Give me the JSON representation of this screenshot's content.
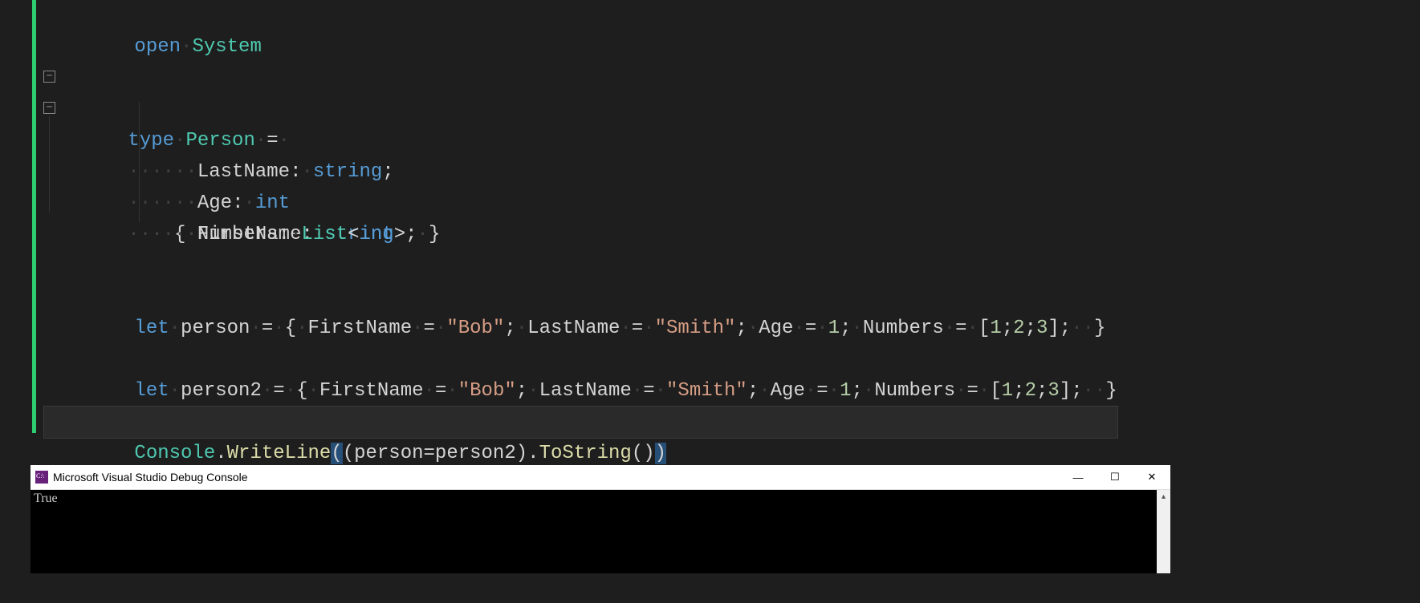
{
  "code": {
    "line1": {
      "open": "open",
      "ws": "·",
      "system": "System"
    },
    "line3": {
      "type": "type",
      "ws": "·",
      "person": "Person",
      "ws2": "·",
      "eq": "=",
      "ws3": "·"
    },
    "line4": {
      "indent": "····",
      "brace": "{",
      "ws": "·",
      "first": "FirstName",
      "colon": ":",
      "ws2": "·",
      "string": "string"
    },
    "line5": {
      "indent": "······",
      "last": "LastName",
      "colon": ":",
      "ws": "·",
      "string": "string",
      "semi": ";"
    },
    "line6": {
      "indent": "······",
      "age": "Age",
      "colon": ":",
      "ws": "·",
      "int": "int"
    },
    "line7": {
      "indent": "······",
      "numbers": "Numbers",
      "colon": ":",
      "ws": "·",
      "list": "List",
      "lt": "<",
      "int": "int",
      "gt": ">",
      "semi": ";",
      "ws2": "·",
      "brace": "}"
    },
    "line10": {
      "let": "let",
      "ws": "·",
      "person": "person",
      "ws2": "·",
      "eq": "=",
      "ws3": "·",
      "brace": "{",
      "ws4": "·",
      "first": "FirstName",
      "ws5": "·",
      "eq2": "=",
      "ws6": "·",
      "bob": "\"Bob\"",
      "semi": ";",
      "ws7": "·",
      "last": "LastName",
      "ws8": "·",
      "eq3": "=",
      "ws9": "·",
      "smith": "\"Smith\"",
      "semi2": ";",
      "ws10": "·",
      "age": "Age",
      "ws11": "·",
      "eq4": "=",
      "ws12": "·",
      "one": "1",
      "semi3": ";",
      "ws13": "·",
      "numbers": "Numbers",
      "ws14": "·",
      "eq5": "=",
      "ws15": "·",
      "lb": "[",
      "v1": "1",
      "s1": ";",
      "v2": "2",
      "s2": ";",
      "v3": "3",
      "rb": "]",
      "semi4": ";",
      "ws16": "··",
      "cbrace": "}"
    },
    "line12": {
      "let": "let",
      "ws": "·",
      "person": "person2",
      "ws2": "·",
      "eq": "=",
      "ws3": "·",
      "brace": "{",
      "ws4": "·",
      "first": "FirstName",
      "ws5": "·",
      "eq2": "=",
      "ws6": "·",
      "bob": "\"Bob\"",
      "semi": ";",
      "ws7": "·",
      "last": "LastName",
      "ws8": "·",
      "eq3": "=",
      "ws9": "·",
      "smith": "\"Smith\"",
      "semi2": ";",
      "ws10": "·",
      "age": "Age",
      "ws11": "·",
      "eq4": "=",
      "ws12": "·",
      "one": "1",
      "semi3": ";",
      "ws13": "·",
      "numbers": "Numbers",
      "ws14": "·",
      "eq5": "=",
      "ws15": "·",
      "lb": "[",
      "v1": "1",
      "s1": ";",
      "v2": "2",
      "s2": ";",
      "v3": "3",
      "rb": "]",
      "semi4": ";",
      "ws16": "··",
      "cbrace": "}"
    },
    "line14": {
      "console": "Console",
      "dot": ".",
      "write": "WriteLine",
      "lp": "(",
      "lp2": "(",
      "p1": "person",
      "eq": "=",
      "p2": "person2",
      "rp": ")",
      "dot2": ".",
      "ts": "ToString",
      "lp3": "(",
      "rp2": ")",
      "rp3": ")"
    }
  },
  "console": {
    "title": "Microsoft Visual Studio Debug Console",
    "output": "True"
  },
  "fold": {
    "minus": "−"
  }
}
